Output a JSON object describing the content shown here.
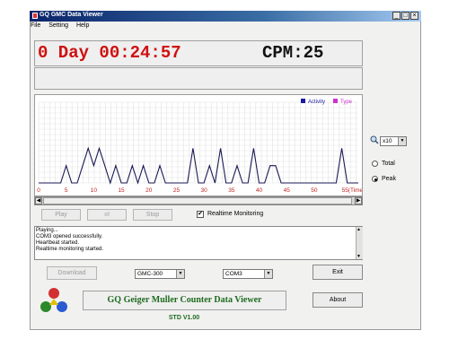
{
  "window": {
    "title": "GQ GMC Data Viewer",
    "controls": [
      "_",
      "□",
      "×"
    ]
  },
  "menu": [
    "File",
    "Setting",
    "Help"
  ],
  "display": {
    "timer": "0 Day 00:24:57",
    "cpm": "CPM:25"
  },
  "chart_data": {
    "type": "line",
    "legend": [
      {
        "name": "Activity",
        "color": "#1a1aa0"
      },
      {
        "name": "Type",
        "color": "#cc33cc"
      }
    ],
    "xticks": [
      "0",
      "5",
      "10",
      "15",
      "20",
      "25",
      "30",
      "35",
      "40",
      "45",
      "50",
      "55(Time)S"
    ],
    "xlim": [
      0,
      58
    ],
    "ylim": [
      0,
      3
    ],
    "grid": true,
    "series": [
      {
        "name": "Activity",
        "x": [
          0,
          4,
          5,
          6,
          7,
          8,
          9,
          10,
          11,
          12,
          13,
          14,
          15,
          16,
          17,
          18,
          19,
          20,
          21,
          22,
          23,
          24,
          25,
          26,
          27,
          28,
          29,
          30,
          31,
          32,
          33,
          34,
          35,
          36,
          37,
          38,
          39,
          40,
          41,
          42,
          43,
          44,
          45,
          46,
          47,
          48,
          49,
          50,
          51,
          52,
          53,
          54,
          55,
          56,
          57,
          58
        ],
        "y": [
          0,
          0,
          1,
          0,
          0,
          1,
          2,
          1,
          2,
          1,
          0,
          1,
          0,
          0,
          1,
          0,
          1,
          0,
          0,
          1,
          0,
          0,
          0,
          0,
          0,
          2,
          0,
          0,
          1,
          0,
          2,
          0,
          0,
          1,
          0,
          0,
          2,
          0,
          0,
          1,
          1,
          0,
          0,
          0,
          0,
          0,
          0,
          0,
          0,
          0,
          0,
          0,
          2,
          0,
          0,
          0
        ]
      }
    ]
  },
  "transport": {
    "play": "Play",
    "pause": "ııI",
    "stop": "Stop",
    "realtime_label": "Realtime Monitoring",
    "realtime_checked": "✔"
  },
  "log": [
    "Playing...",
    "COM3 opened successfully.",
    "Heartbeat started.",
    "Realtime monitoring started."
  ],
  "side": {
    "zoom_value": "x10",
    "radio_total": "Total",
    "radio_peak": "Peak",
    "selected": "Peak"
  },
  "bottom": {
    "download": "Download",
    "model": "GMC-300",
    "port": "COM3",
    "exit": "Exit",
    "about": "About"
  },
  "banner": {
    "title": "GQ Geiger Muller Counter Data Viewer",
    "version": "STD V1.00"
  }
}
